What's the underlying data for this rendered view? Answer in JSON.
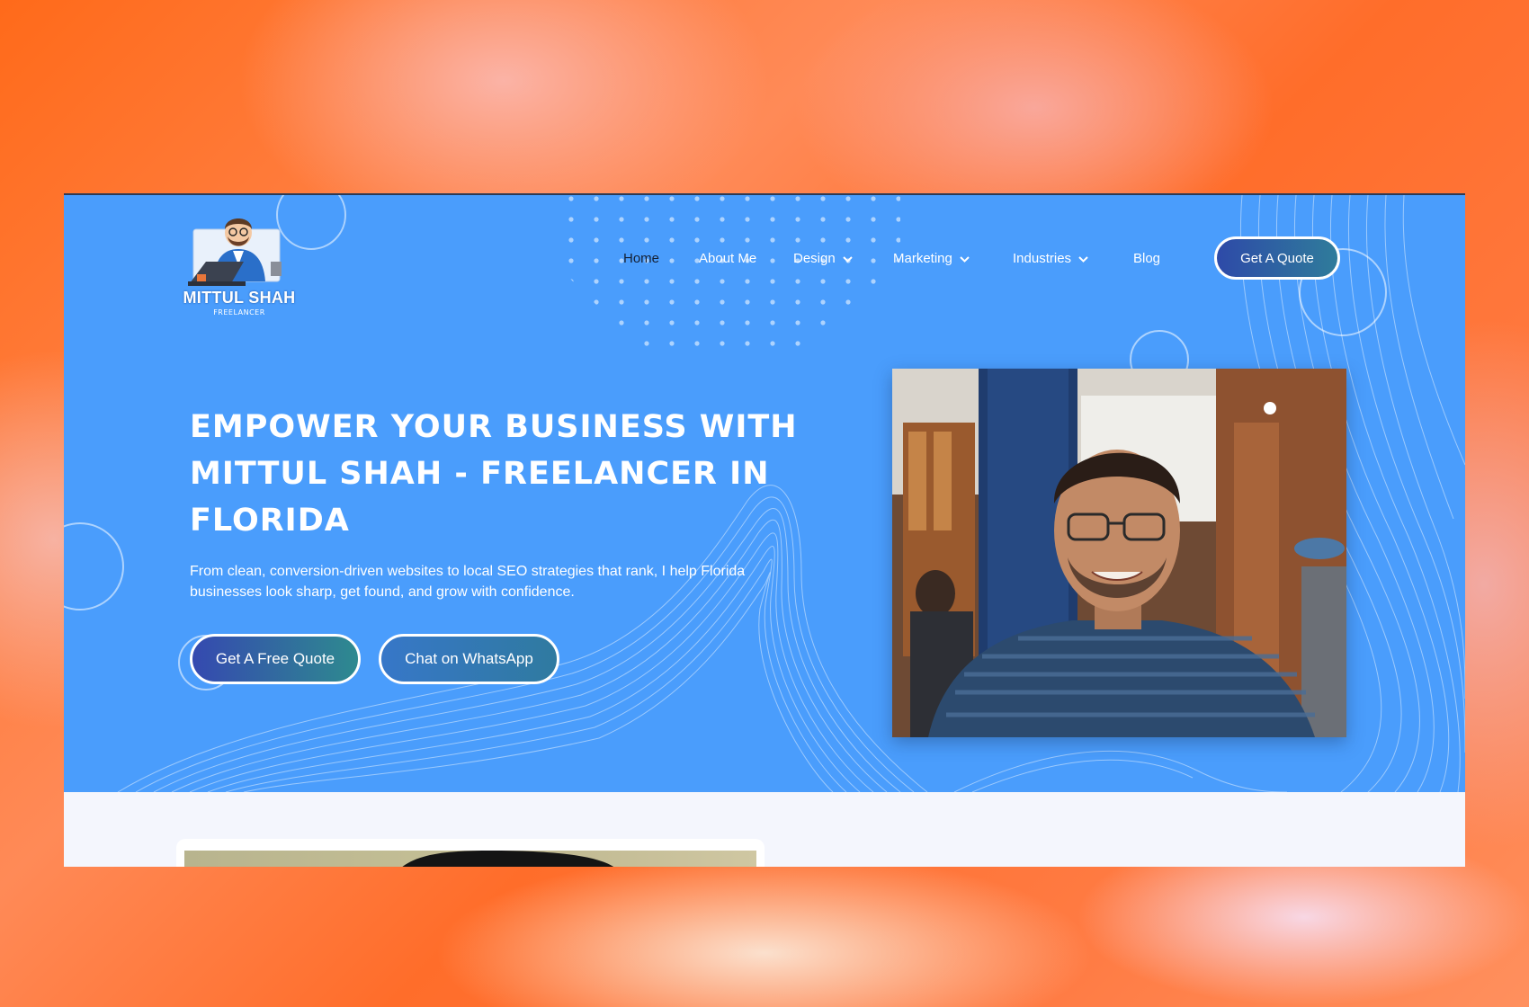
{
  "brand": {
    "name": "MITTUL SHAH",
    "tagline": "FREELANCER"
  },
  "nav": {
    "items": [
      {
        "label": "Home",
        "active": true,
        "dropdown": false
      },
      {
        "label": "About Me",
        "active": false,
        "dropdown": false
      },
      {
        "label": "Design",
        "active": false,
        "dropdown": true
      },
      {
        "label": "Marketing",
        "active": false,
        "dropdown": true
      },
      {
        "label": "Industries",
        "active": false,
        "dropdown": true
      },
      {
        "label": "Blog",
        "active": false,
        "dropdown": false
      }
    ],
    "cta_label": "Get A Quote"
  },
  "hero": {
    "headline": "Empower Your Business With Mittul Shah - Freelancer In Florida",
    "subtext": "From clean, conversion-driven websites to local SEO strategies that rank, I help Florida businesses look sharp, get found, and grow with confidence.",
    "primary_cta": "Get A Free Quote",
    "secondary_cta": "Chat on WhatsApp"
  },
  "colors": {
    "hero_bg": "#4a9dfc",
    "page_bg": "#f4f6fd",
    "active_nav": "#152033",
    "button_gradient_start": "#2e4aa8",
    "button_gradient_end": "#2f7c9b"
  },
  "icons": {
    "nav_dropdown": "chevron-down-icon"
  }
}
